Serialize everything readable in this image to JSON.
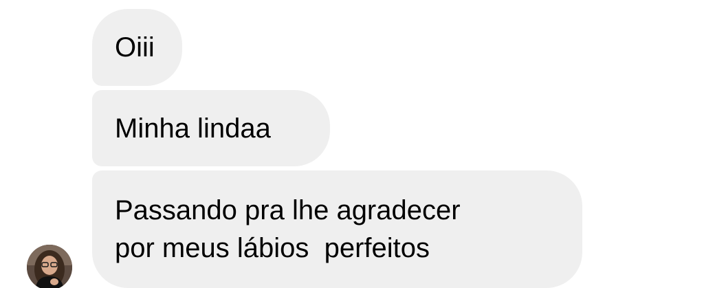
{
  "messages": [
    {
      "text": "Oiii"
    },
    {
      "text": "Minha lindaa"
    },
    {
      "text": "Passando pra lhe agradecer\npor meus lábios  perfeitos"
    }
  ],
  "sender": {
    "avatar_icon": "person-avatar-photo"
  },
  "colors": {
    "background": "#ffffff",
    "bubble": "#efefef",
    "text": "#000000"
  }
}
